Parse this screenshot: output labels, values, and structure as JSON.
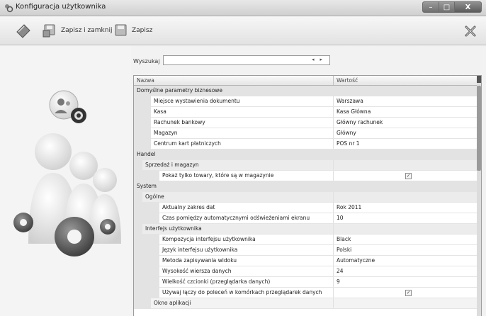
{
  "window": {
    "title": "Konfiguracja użytkownika",
    "controls": {
      "minimize": "–",
      "maximize": "□",
      "close": "X"
    }
  },
  "toolbar": {
    "save_close_label": "Zapisz i zamknij",
    "save_label": "Zapisz"
  },
  "search": {
    "label": "Wyszukaj",
    "value": "",
    "prev_symbol": "◂",
    "next_symbol": "▸"
  },
  "grid": {
    "columns": {
      "name": "Nazwa",
      "value": "Wartość"
    },
    "rows": [
      {
        "name": "Domyślne parametry biznesowe",
        "value": "",
        "level": 0,
        "group": true
      },
      {
        "name": "Miejsce wystawienia dokumentu",
        "value": "Warszawa",
        "level": 1,
        "group": false
      },
      {
        "name": "Kasa",
        "value": "Kasa Główna",
        "level": 1,
        "group": false
      },
      {
        "name": "Rachunek bankowy",
        "value": "Główny rachunek",
        "level": 1,
        "group": false
      },
      {
        "name": "Magazyn",
        "value": "Główny",
        "level": 1,
        "group": false
      },
      {
        "name": "Centrum kart płatniczych",
        "value": "POS nr 1",
        "level": 1,
        "group": false
      },
      {
        "name": "Handel",
        "value": "",
        "level": 0,
        "group": true
      },
      {
        "name": "Sprzedaż i magazyn",
        "value": "",
        "level": 1,
        "group": true
      },
      {
        "name": "Pokaż tylko towary, które są w magazynie",
        "value": "",
        "level": 2,
        "group": false,
        "checkbox": true,
        "checked": true
      },
      {
        "name": "System",
        "value": "",
        "level": 0,
        "group": true
      },
      {
        "name": "Ogólne",
        "value": "",
        "level": 1,
        "group": true
      },
      {
        "name": "Aktualny zakres dat",
        "value": "Rok 2011",
        "level": 2,
        "group": false
      },
      {
        "name": "Czas pomiędzy automatycznymi odświeżeniami ekranu",
        "value": "10",
        "level": 2,
        "group": false
      },
      {
        "name": "Interfejs użytkownika",
        "value": "",
        "level": 1,
        "group": true
      },
      {
        "name": "Kompozycja interfejsu użytkownika",
        "value": "Black",
        "level": 2,
        "group": false
      },
      {
        "name": "Język interfejsu użytkownika",
        "value": "Polski",
        "level": 2,
        "group": false
      },
      {
        "name": "Metoda zapisywania widoku",
        "value": "Automatyczne",
        "level": 2,
        "group": false
      },
      {
        "name": "Wysokość wiersza danych",
        "value": "24",
        "level": 2,
        "group": false
      },
      {
        "name": "Wielkość czcionki (przeglądarka danych)",
        "value": "9",
        "level": 2,
        "group": false
      },
      {
        "name": "Używaj łączy do poleceń w komórkach przeglądarek danych",
        "value": "",
        "level": 2,
        "group": false,
        "checkbox": true,
        "checked": true
      },
      {
        "name": "Okno aplikacji",
        "value": "",
        "level": 2,
        "group": true
      }
    ]
  },
  "colors": {
    "accent": "#dcdcdc",
    "group_bg": "#e3e3e3"
  }
}
